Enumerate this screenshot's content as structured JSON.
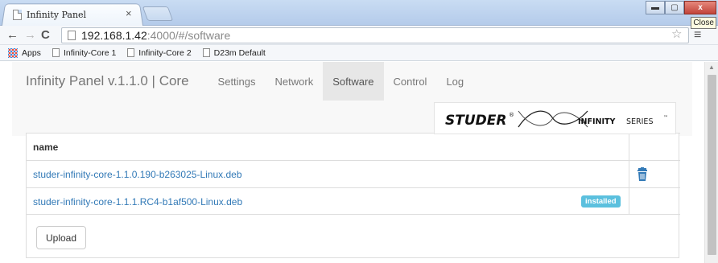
{
  "browser": {
    "tab_title": "Infinity Panel",
    "tab_close": "×",
    "tooltip": "Close",
    "window_controls": {
      "minimize": "▬",
      "maximize": "▢",
      "close": "x"
    },
    "nav": {
      "back": "←",
      "forward": "→",
      "reload": "C"
    },
    "url_host": "192.168.1.42",
    "url_path": ":4000/#/software",
    "star": "☆",
    "menu": "≡",
    "bookmarks": [
      {
        "label": "Apps"
      },
      {
        "label": "Infinity-Core 1"
      },
      {
        "label": "Infinity-Core 2"
      },
      {
        "label": "D23m Default"
      }
    ]
  },
  "app": {
    "brand": "Infinity Panel v.1.1.0 | Core",
    "nav": [
      {
        "label": "Settings",
        "active": false
      },
      {
        "label": "Network",
        "active": false
      },
      {
        "label": "Software",
        "active": true
      },
      {
        "label": "Control",
        "active": false
      },
      {
        "label": "Log",
        "active": false
      }
    ],
    "logo": {
      "studer": "STUDER",
      "reg": "®",
      "infinity": "INFINITY",
      "series": "SERIES",
      "tm": "™"
    }
  },
  "software": {
    "header": "name",
    "files": [
      {
        "name": "studer-infinity-core-1.1.0.190-b263025-Linux.deb",
        "installed": false,
        "icon": "trash-icon"
      },
      {
        "name": "studer-infinity-core-1.1.1.RC4-b1af500-Linux.deb",
        "installed": true,
        "badge": "installed"
      }
    ],
    "upload_label": "Upload"
  },
  "colors": {
    "link": "#337ab7",
    "badge": "#5bc0de",
    "navbar": "#f8f8f8",
    "active_nav": "#e7e7e7"
  }
}
